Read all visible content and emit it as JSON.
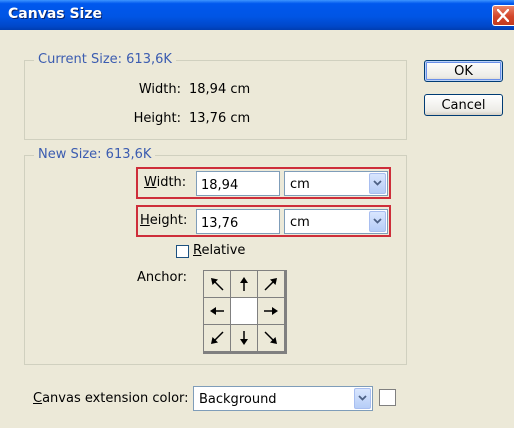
{
  "window": {
    "title": "Canvas Size"
  },
  "current": {
    "legend": "Current Size: 613,6K",
    "width_label": "Width:",
    "width_value": "18,94 cm",
    "height_label": "Height:",
    "height_value": "13,76 cm"
  },
  "new_size": {
    "legend": "New Size: 613,6K",
    "width_label_u": "W",
    "width_label_rest": "idth:",
    "width_value": "18,94",
    "width_unit": "cm",
    "height_label_u": "H",
    "height_label_rest": "eight:",
    "height_value": "13,76",
    "height_unit": "cm",
    "relative_u": "R",
    "relative_rest": "elative",
    "anchor_label": "Anchor:"
  },
  "buttons": {
    "ok": "OK",
    "cancel": "Cancel"
  },
  "extension": {
    "label_u": "C",
    "label_rest": "anvas extension color:",
    "value": "Background"
  },
  "colors": {
    "accent_highlight": "#CE2E3A",
    "legend_text": "#3B5CB0",
    "titlebar": "#0055E5",
    "dialog_bg": "#ECE9D8"
  },
  "icons": {
    "anchor_arrows": [
      "arrow-up-left-icon",
      "arrow-up-icon",
      "arrow-up-right-icon",
      "arrow-left-icon",
      "anchor-center",
      "arrow-right-icon",
      "arrow-down-left-icon",
      "arrow-down-icon",
      "arrow-down-right-icon"
    ]
  }
}
